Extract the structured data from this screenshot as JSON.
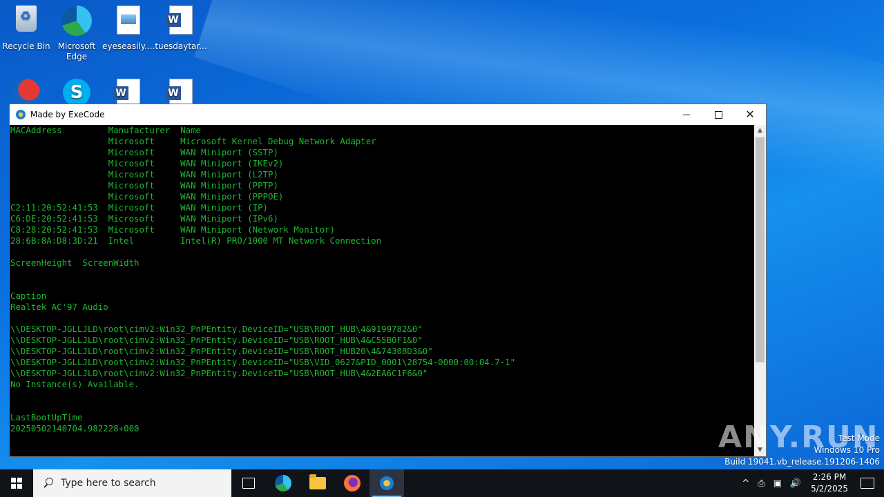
{
  "desktop": {
    "icons": [
      {
        "label": "Recycle Bin"
      },
      {
        "label": "Microsoft Edge"
      },
      {
        "label": "eyeseasily...."
      },
      {
        "label": "tuesdaytar..."
      }
    ]
  },
  "window": {
    "title": "Made by ExeCode",
    "lines": [
      "MACAddress         Manufacturer  Name",
      "                   Microsoft     Microsoft Kernel Debug Network Adapter",
      "                   Microsoft     WAN Miniport (SSTP)",
      "                   Microsoft     WAN Miniport (IKEv2)",
      "                   Microsoft     WAN Miniport (L2TP)",
      "                   Microsoft     WAN Miniport (PPTP)",
      "                   Microsoft     WAN Miniport (PPPOE)",
      "C2:11:20:52:41:53  Microsoft     WAN Miniport (IP)",
      "C6:DE:20:52:41:53  Microsoft     WAN Miniport (IPv6)",
      "C8:28:20:52:41:53  Microsoft     WAN Miniport (Network Monitor)",
      "28:6B:8A:D8:3D:21  Intel         Intel(R) PRO/1000 MT Network Connection",
      "",
      "ScreenHeight  ScreenWidth",
      "",
      "",
      "Caption",
      "Realtek AC'97 Audio",
      "",
      "\\\\DESKTOP-JGLLJLD\\root\\cimv2:Win32_PnPEntity.DeviceID=\"USB\\ROOT_HUB\\4&9199782&0\"",
      "\\\\DESKTOP-JGLLJLD\\root\\cimv2:Win32_PnPEntity.DeviceID=\"USB\\ROOT_HUB\\4&C55B0F1&0\"",
      "\\\\DESKTOP-JGLLJLD\\root\\cimv2:Win32_PnPEntity.DeviceID=\"USB\\ROOT_HUB20\\4&74308D3&0\"",
      "\\\\DESKTOP-JGLLJLD\\root\\cimv2:Win32_PnPEntity.DeviceID=\"USB\\VID_0627&PID_0001\\28754-0000:00:04.7-1\"",
      "\\\\DESKTOP-JGLLJLD\\root\\cimv2:Win32_PnPEntity.DeviceID=\"USB\\ROOT_HUB\\4&2EA6C1F6&0\"",
      "No Instance(s) Available.",
      "",
      "",
      "LastBootUpTime",
      "20250502140704.982228+000"
    ]
  },
  "watermark": {
    "brand": "ANY.RUN",
    "line1": "Test Mode",
    "line2": "Windows 10 Pro",
    "line3": "Build 19041.vb_release.191206-1406"
  },
  "taskbar": {
    "search_placeholder": "Type here to search",
    "time": "2:26 PM",
    "date": "5/2/2025",
    "tray_chevron": "^",
    "tray_icons": [
      "⎙",
      "▣",
      "🔊"
    ]
  },
  "colors": {
    "console_text": "#1fb832",
    "console_bg": "#000000",
    "taskbar_bg": "#101317"
  }
}
